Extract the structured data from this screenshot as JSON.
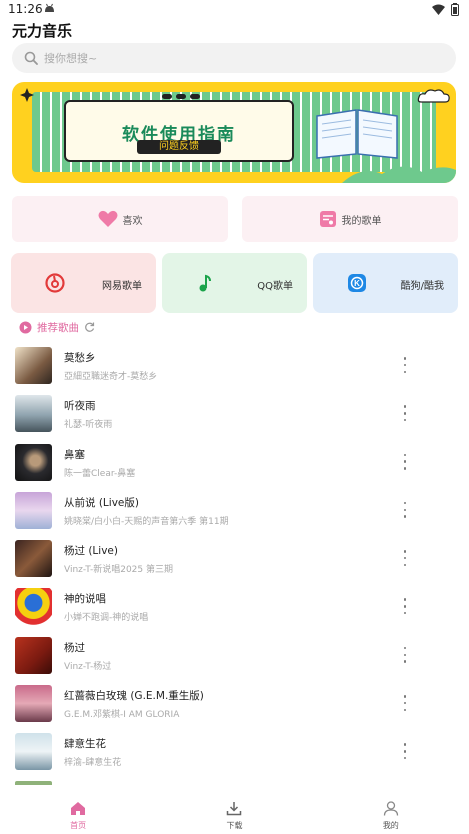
{
  "status_bar": {
    "time": "11:26"
  },
  "header": {
    "title": "元力音乐"
  },
  "search": {
    "placeholder": "搜你想搜~"
  },
  "banner": {
    "title": "软件使用指南",
    "subtitle": "问题反馈"
  },
  "quick_links": [
    {
      "label": "喜欢",
      "icon": "heart-icon"
    },
    {
      "label": "我的歌单",
      "icon": "playlist-icon"
    }
  ],
  "sources": [
    {
      "label": "网易歌单",
      "icon": "netease-icon"
    },
    {
      "label": "QQ歌单",
      "icon": "qq-music-icon"
    },
    {
      "label": "酷狗/酷我",
      "icon": "kugou-icon"
    }
  ],
  "recommend": {
    "title": "推荐歌曲"
  },
  "songs": [
    {
      "title": "莫愁乡",
      "subtitle": "亞細亞職迷奇才-莫愁乡"
    },
    {
      "title": "听夜雨",
      "subtitle": "礼瑟-听夜雨"
    },
    {
      "title": "鼻塞",
      "subtitle": "陈一蕾Clear-鼻塞"
    },
    {
      "title": "从前说 (Live版)",
      "subtitle": "姚晓棠/白小白-天赐的声音第六季 第11期"
    },
    {
      "title": "杨过 (Live)",
      "subtitle": "Vinz-T-新说唱2025 第三期"
    },
    {
      "title": "神的说唱",
      "subtitle": "小婵不跑调-神的说唱"
    },
    {
      "title": "杨过",
      "subtitle": "Vinz-T-杨过"
    },
    {
      "title": "红蔷薇白玫瑰 (G.E.M.重生版)",
      "subtitle": "G.E.M.邓紫棋-I AM GLORIA"
    },
    {
      "title": "肆意生花",
      "subtitle": "梓渝-肆意生花"
    }
  ],
  "bottom_nav": [
    {
      "label": "首页",
      "icon": "home-icon",
      "active": true
    },
    {
      "label": "下载",
      "icon": "download-icon",
      "active": false
    },
    {
      "label": "我的",
      "icon": "user-icon",
      "active": false
    }
  ],
  "colors": {
    "accent": "#e06aa0",
    "banner_yellow": "#ffd11f",
    "banner_green": "#1a8a5a"
  }
}
